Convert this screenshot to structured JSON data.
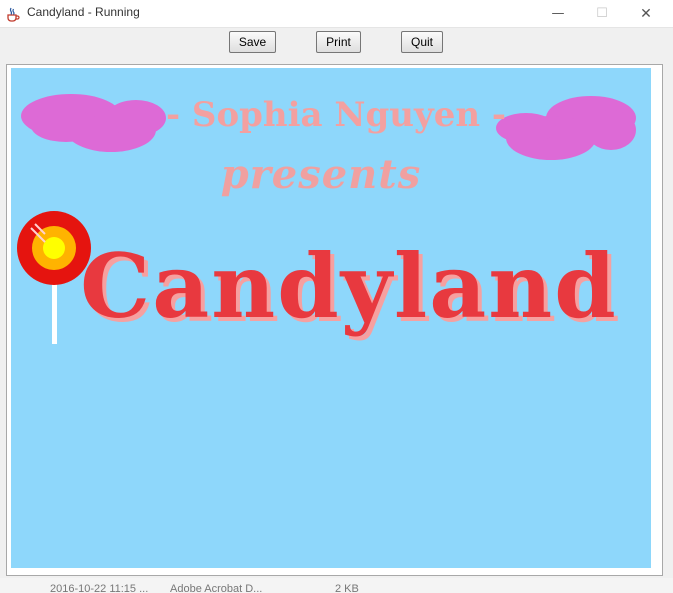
{
  "window": {
    "title": "Candyland - Running",
    "icon": "java-cup-icon",
    "controls": {
      "minimize": "—",
      "maximize": "☐",
      "close": "✕"
    }
  },
  "toolbar": {
    "save_label": "Save",
    "print_label": "Print",
    "quit_label": "Quit"
  },
  "canvas": {
    "background": "#8ed7fb",
    "author": "- Sophia Nguyen -",
    "presents": "presents",
    "app_name": "Candyland",
    "colors": {
      "author": "#f3a0a0",
      "presents": "#f0a0a0",
      "app_name": "#e8393f",
      "clouds": "#dd6ad6",
      "lollipop_outer": "#e5140f",
      "lollipop_mid": "#ffb300",
      "lollipop_center": "#ffff00",
      "stick": "#ffffff"
    },
    "icons": [
      "cloud-left-icon",
      "cloud-right-icon",
      "lollipop-icon"
    ]
  },
  "background_partial": {
    "date": "2016-10-22 11:15 ...",
    "program": "Adobe Acrobat D...",
    "size": "2 KB"
  }
}
